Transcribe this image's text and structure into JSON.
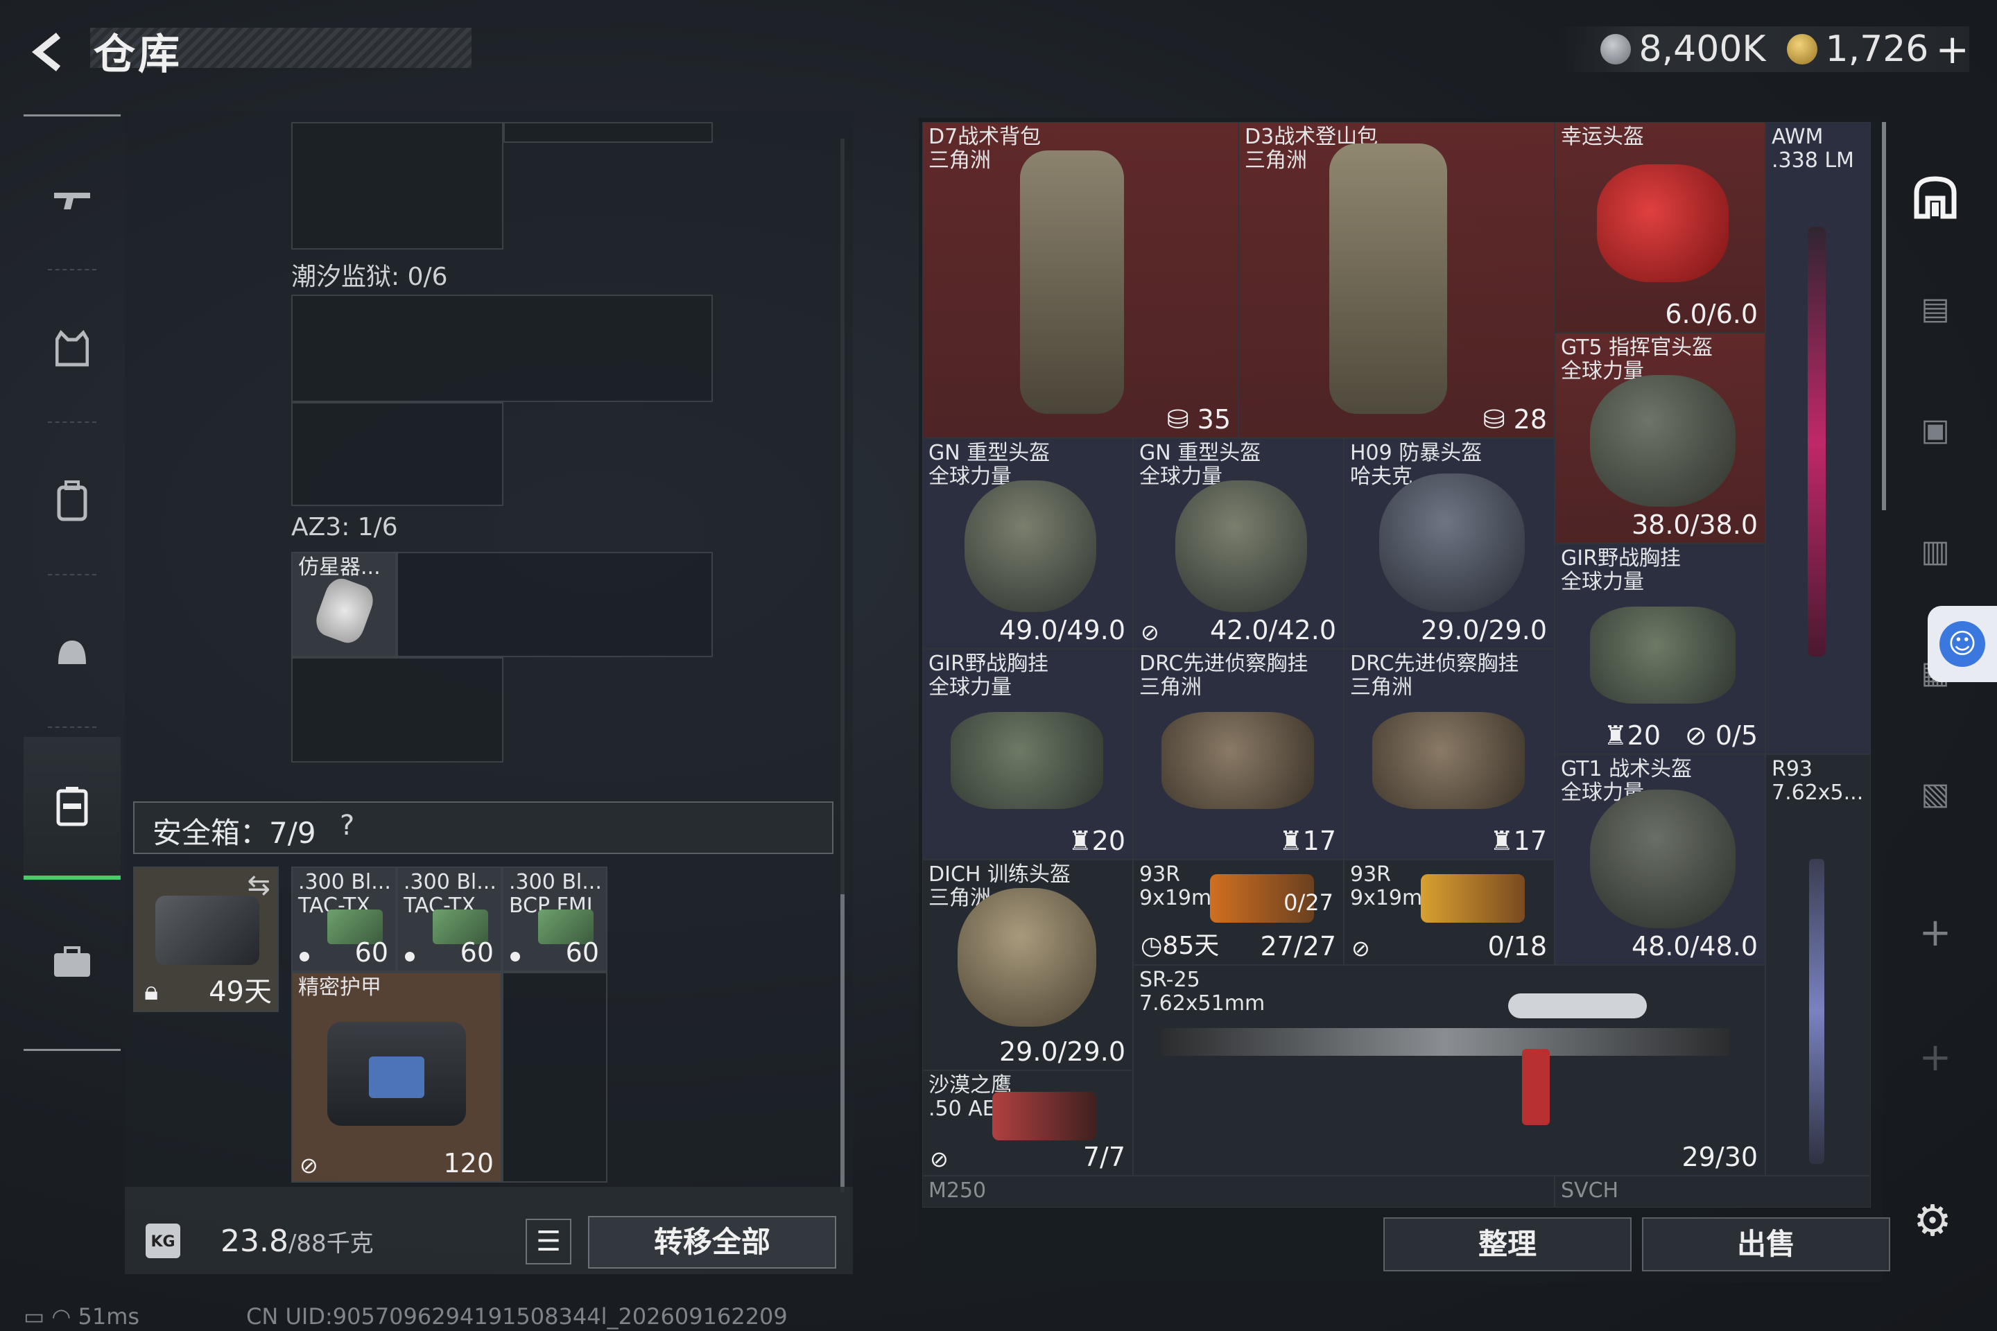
{
  "header": {
    "back_label": "<",
    "title": "仓库"
  },
  "currency": {
    "silver": "8,400K",
    "gold": "1,726",
    "add": "+"
  },
  "left_nav": {
    "icons": [
      "rifle-icon",
      "vest-icon",
      "backpack-icon",
      "helmet-icon",
      "safe-case-icon",
      "briefcase-icon"
    ]
  },
  "inventory": {
    "sections": [
      {
        "label": "潮汐监狱: 0/6"
      },
      {
        "label": "AZ3: 1/6"
      }
    ],
    "az3_item": {
      "name": "仿星器..."
    },
    "safebox": {
      "label": "安全箱：7/9",
      "help": "?"
    },
    "safebox_items": {
      "case_time": "49天",
      "ammo": [
        {
          "name": ".300 Bl...\nTAC-TX",
          "count": "60"
        },
        {
          "name": ".300 Bl...\nTAC-TX",
          "count": "60"
        },
        {
          "name": ".300 Bl...\nBCP FMJ",
          "count": "60"
        }
      ],
      "armor": {
        "name": "精密护甲",
        "value": "120"
      }
    },
    "weight": {
      "current": "23.8",
      "max": "/88千克"
    },
    "transfer_all": "转移全部"
  },
  "stash": {
    "items": [
      {
        "name": "D7战术背包\n三角洲",
        "value": "35"
      },
      {
        "name": "D3战术登山包\n三角洲",
        "value": "28"
      },
      {
        "name": "幸运头盔",
        "value": "6.0/6.0"
      },
      {
        "name": "AWM\n.338 LM"
      },
      {
        "name": "GT5 指挥官头盔\n全球力量",
        "value": "38.0/38.0"
      },
      {
        "name": "GN 重型头盔\n全球力量",
        "value": "49.0/49.0"
      },
      {
        "name": "GN 重型头盔\n全球力量",
        "value": "42.0/42.0"
      },
      {
        "name": "H09 防暴头盔\n哈夫克",
        "value": "29.0/29.0"
      },
      {
        "name": "GIR野战胸挂\n全球力量",
        "value": "20",
        "value2": "0/5"
      },
      {
        "name": "GIR野战胸挂\n全球力量",
        "value": "20"
      },
      {
        "name": "DRC先进侦察胸挂\n三角洲",
        "value": "17"
      },
      {
        "name": "DRC先进侦察胸挂\n三角洲",
        "value": "17"
      },
      {
        "name": "GT1 战术头盔\n全球力量",
        "value": "48.0/48.0"
      },
      {
        "name": "R93\n7.62x5..."
      },
      {
        "name": "DICH 训练头盔\n三角洲",
        "value": "29.0/29.0"
      },
      {
        "name": "93R\n9x19mm",
        "value": "27/27",
        "value2": "0/27",
        "left": "85天"
      },
      {
        "name": "93R\n9x19mm",
        "value": "0/18"
      },
      {
        "name": "SR-25\n7.62x51mm",
        "value": "29/30"
      },
      {
        "name": "沙漠之鹰\n.50 AE",
        "value": "7/7"
      }
    ],
    "bottom_labels": [
      "M250",
      "SVCH"
    ],
    "sort_label": "整理",
    "sell_label": "出售"
  },
  "right_nav": {
    "icons": [
      "stash-home-icon",
      "gti-case-icon",
      "iv-add-icon",
      "iv-folder-icon",
      "iv-case-icon",
      "gti-box-icon",
      "plus-icon",
      "plus-icon"
    ],
    "plus": "+"
  },
  "status": {
    "ping": "51ms",
    "uid": "CN UID:9057096294191508344l_202609162209"
  },
  "colors": {
    "active_green": "#4ec96a",
    "red_rarity": "#7a2d2d",
    "purple_rarity": "#303244",
    "accessibility_blue": "#3a78e0"
  }
}
